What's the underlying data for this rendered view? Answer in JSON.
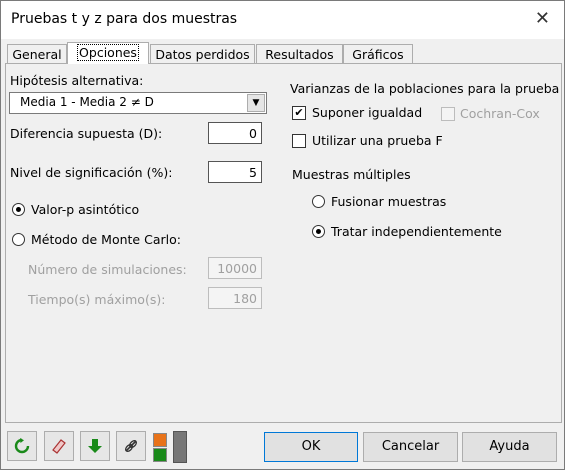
{
  "window": {
    "title": "Pruebas t y z para dos muestras",
    "close": "✕"
  },
  "tabs": [
    {
      "label": "General"
    },
    {
      "label": "Opciones"
    },
    {
      "label": "Datos perdidos"
    },
    {
      "label": "Resultados"
    },
    {
      "label": "Gráficos"
    }
  ],
  "options": {
    "alt_label": "Hipótesis alternativa:",
    "alt_value": "Media 1 - Media 2 ≠ D",
    "diff_label": "Diferencia supuesta (D):",
    "diff_value": "0",
    "sig_label": "Nivel de significación (%):",
    "sig_value": "5",
    "pvalue_asym": "Valor-p asintótico",
    "pvalue_asym_selected": true,
    "monte_carlo": "Método de Monte Carlo:",
    "sims_label": "Número de simulaciones:",
    "sims_value": "10000",
    "time_label": "Tiempo(s) máximo(s):",
    "time_value": "180",
    "variances_label": "Varianzas de la poblaciones para la prueba",
    "equality": "Suponer igualdad",
    "equality_checked": true,
    "cochran": "Cochran-Cox",
    "ftest": "Utilizar una prueba F",
    "multiple_label": "Muestras múltiples",
    "merge": "Fusionar muestras",
    "independent": "Tratar independientemente",
    "independent_selected": true
  },
  "footer": {
    "ok": "OK",
    "cancel": "Cancelar",
    "help": "Ayuda"
  },
  "icons": [
    "reset-icon",
    "eraser-icon",
    "download-icon",
    "link-icon",
    "color-icon"
  ]
}
